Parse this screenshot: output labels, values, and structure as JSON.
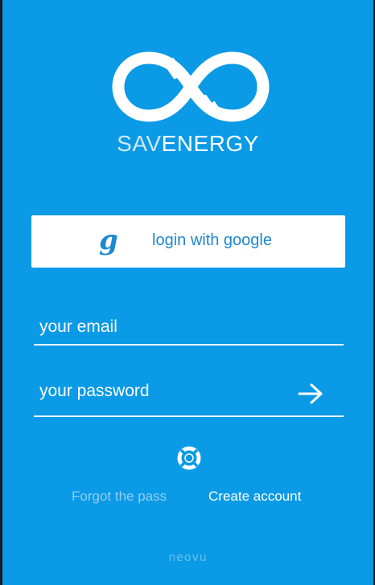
{
  "brand": {
    "part1": "SAV",
    "part2": "ENERGY"
  },
  "google_button": {
    "icon_glyph": "g",
    "label": "login with google"
  },
  "form": {
    "email_placeholder": "your email",
    "password_placeholder": "your password",
    "submit_icon": "arrow-right-icon"
  },
  "help_icon": "lifebuoy-icon",
  "links": {
    "forgot": "Forgot the pass",
    "create": "Create account"
  },
  "footer": "neovu",
  "colors": {
    "background": "#0a9ae6",
    "button_bg": "#ffffff",
    "google_blue": "#1e88d0",
    "muted_link": "#8fcef5"
  }
}
